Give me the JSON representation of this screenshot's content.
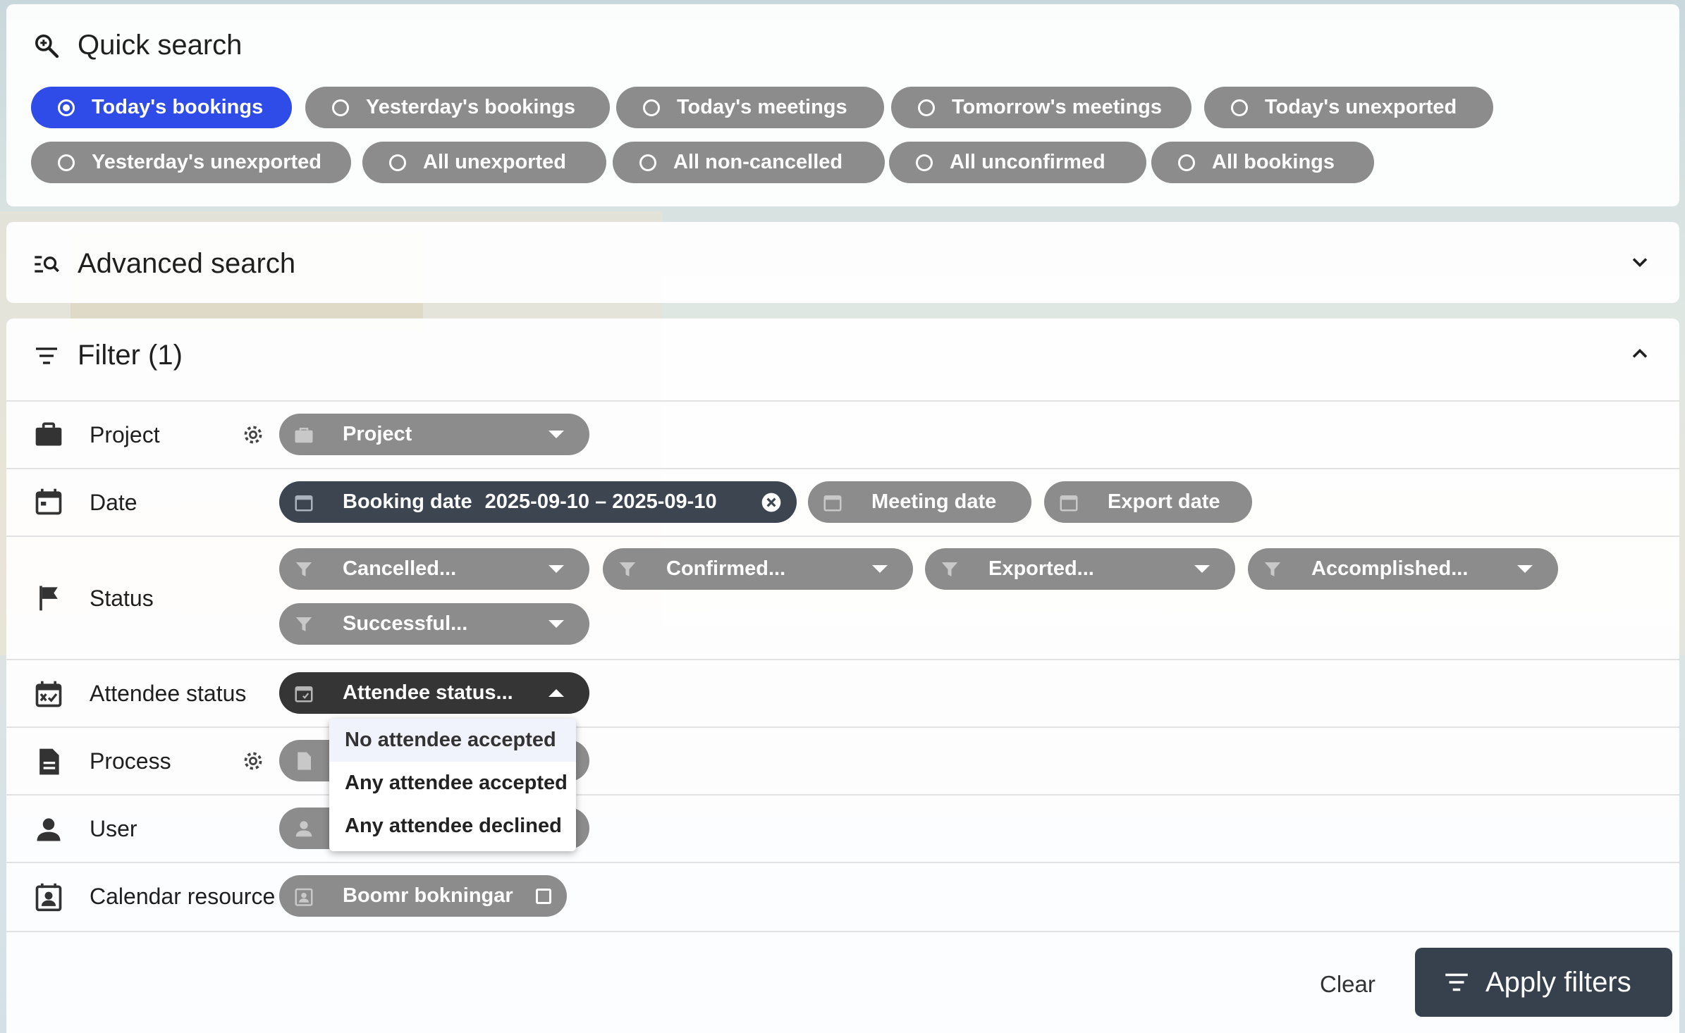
{
  "quick_search": {
    "title": "Quick search",
    "chips": [
      {
        "label": "Today's bookings",
        "selected": true
      },
      {
        "label": "Yesterday's bookings",
        "selected": false
      },
      {
        "label": "Today's meetings",
        "selected": false
      },
      {
        "label": "Tomorrow's meetings",
        "selected": false
      },
      {
        "label": "Today's unexported",
        "selected": false
      },
      {
        "label": "Yesterday's unexported",
        "selected": false
      },
      {
        "label": "All unexported",
        "selected": false
      },
      {
        "label": "All non-cancelled",
        "selected": false
      },
      {
        "label": "All unconfirmed",
        "selected": false
      },
      {
        "label": "All bookings",
        "selected": false
      }
    ]
  },
  "advanced_search": {
    "title": "Advanced search",
    "expanded": false
  },
  "filter": {
    "title": "Filter (1)",
    "expanded": true,
    "rows": {
      "project": {
        "label": "Project",
        "chip": "Project"
      },
      "date": {
        "label": "Date",
        "booking_chip_label": "Booking date",
        "booking_chip_value": "2025-09-10 – 2025-09-10",
        "meeting_chip": "Meeting date",
        "export_chip": "Export date"
      },
      "status": {
        "label": "Status",
        "chips": [
          "Cancelled...",
          "Confirmed...",
          "Exported...",
          "Accomplished...",
          "Successful..."
        ]
      },
      "attendee_status": {
        "label": "Attendee status",
        "chip": "Attendee status...",
        "options": [
          "No attendee accepted",
          "Any attendee accepted",
          "Any attendee declined"
        ]
      },
      "process": {
        "label": "Process"
      },
      "user": {
        "label": "User"
      },
      "calendar_resource": {
        "label": "Calendar resource",
        "chip": "Boomr bokningar",
        "checked": false
      }
    },
    "clear_label": "Clear",
    "apply_label": "Apply filters"
  },
  "colors": {
    "selected_chip": "#2f4be8",
    "chip": "#8c8c8c",
    "active_chip": "#3c4550",
    "apply_button": "#37414d"
  }
}
